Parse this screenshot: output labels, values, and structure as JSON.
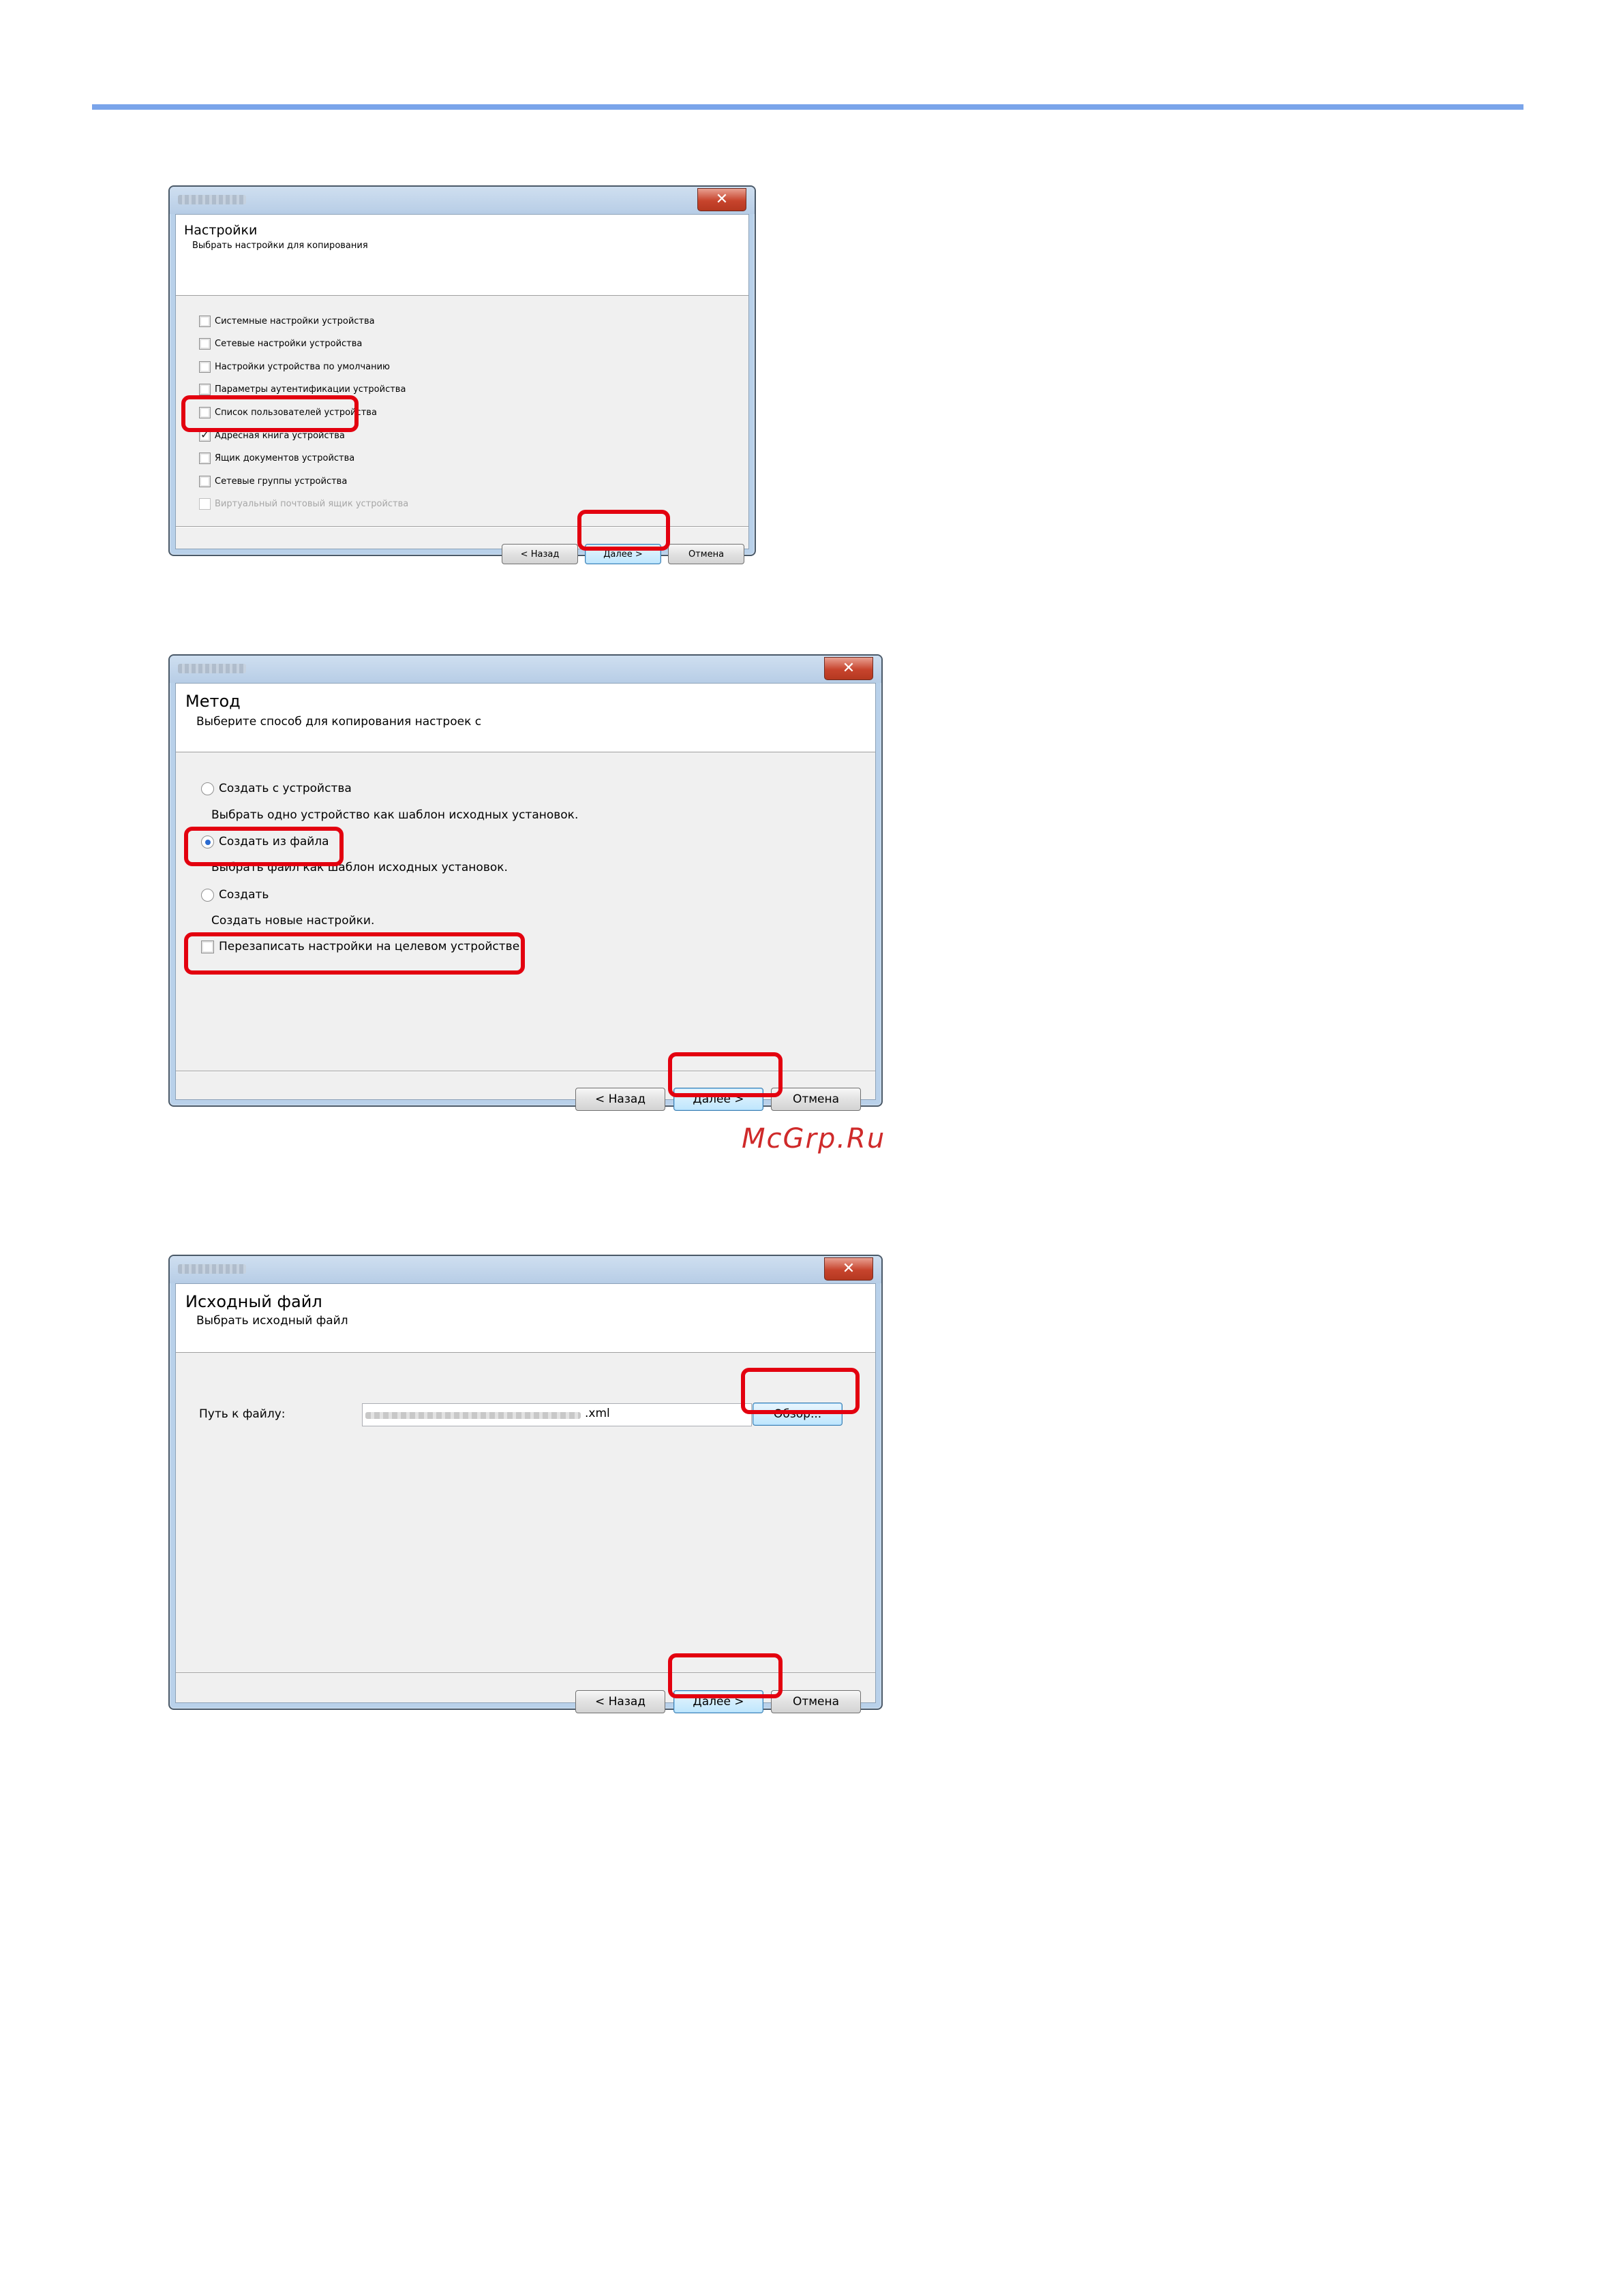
{
  "watermark": "McGrp.Ru",
  "dialog_settings": {
    "title": "Настройки",
    "subtitle": "Выбрать настройки для копирования",
    "options": [
      {
        "label": "Системные настройки устройства",
        "checked": false,
        "enabled": true
      },
      {
        "label": "Сетевые настройки устройства",
        "checked": false,
        "enabled": true
      },
      {
        "label": "Настройки устройства по умолчанию",
        "checked": false,
        "enabled": true
      },
      {
        "label": "Параметры аутентификации устройства",
        "checked": false,
        "enabled": true
      },
      {
        "label": "Список пользователей устройства",
        "checked": false,
        "enabled": true
      },
      {
        "label": "Адресная книга устройства",
        "checked": true,
        "enabled": true
      },
      {
        "label": "Ящик документов устройства",
        "checked": false,
        "enabled": true
      },
      {
        "label": "Сетевые группы устройства",
        "checked": false,
        "enabled": true
      },
      {
        "label": "Виртуальный почтовый ящик устройства",
        "checked": false,
        "enabled": false
      }
    ],
    "back_label": "< Назад",
    "next_label": "Далее >",
    "cancel_label": "Отмена"
  },
  "dialog_method": {
    "title": "Метод",
    "subtitle": "Выберите способ для копирования настроек с",
    "radio_options": [
      {
        "label": "Создать с устройства",
        "desc": "Выбрать одно устройство как шаблон исходных установок.",
        "selected": false
      },
      {
        "label": "Создать из файла",
        "desc": "Выбрать файл как шаблон исходных установок.",
        "selected": true
      },
      {
        "label": "Создать",
        "desc": "Создать новые настройки.",
        "selected": false
      }
    ],
    "overwrite_label": "Перезаписать настройки на целевом устройстве",
    "overwrite_checked": false,
    "back_label": "< Назад",
    "next_label": "Далее >",
    "cancel_label": "Отмена"
  },
  "dialog_source": {
    "title": "Исходный файл",
    "subtitle": "Выбрать исходный файл",
    "path_label": "Путь к файлу:",
    "path_value": ".xml",
    "browse_label": "Обзор...",
    "back_label": "< Назад",
    "next_label": "Далее >",
    "cancel_label": "Отмена"
  },
  "colors": {
    "highlight": "#e3000f",
    "top_rule": "#7aa4ea",
    "watermark": "#cf2a2a"
  }
}
